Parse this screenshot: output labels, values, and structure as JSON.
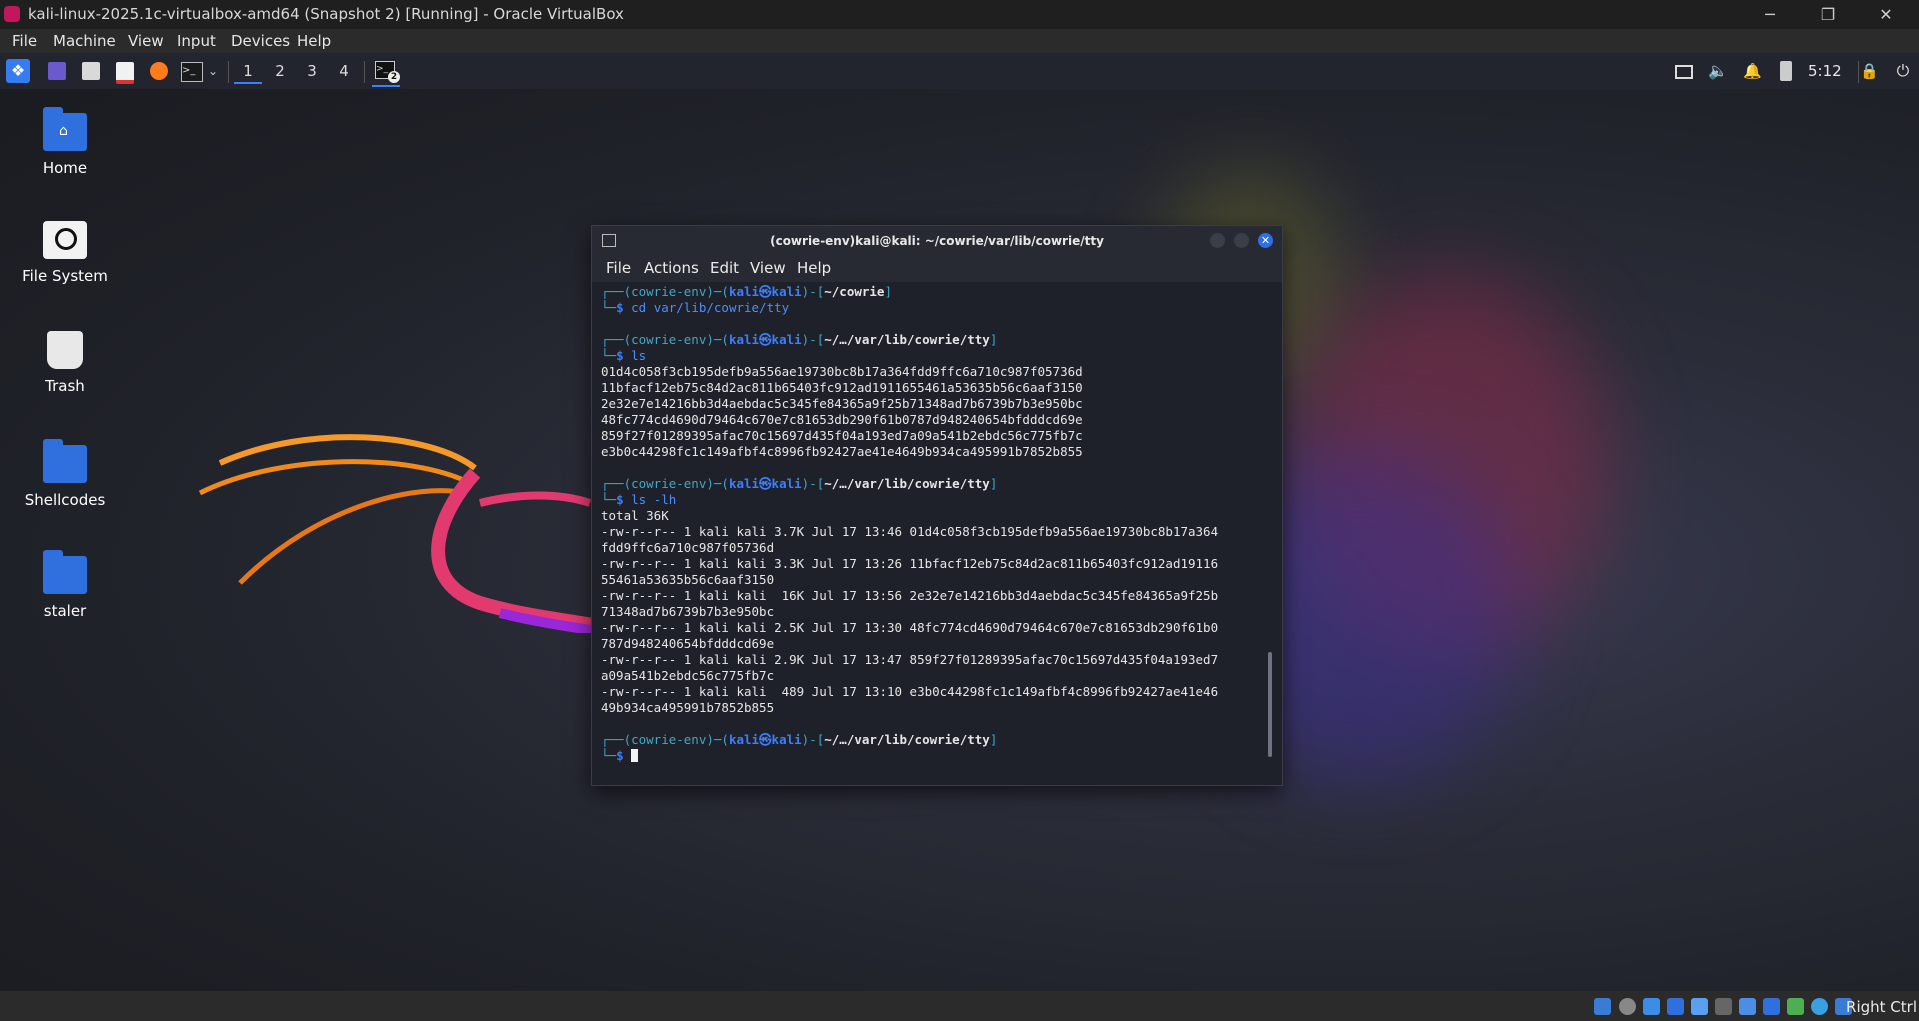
{
  "vbox": {
    "window_title": "kali-linux-2025.1c-virtualbox-amd64 (Snapshot 2) [Running] - Oracle VirtualBox",
    "menu": [
      "File",
      "Machine",
      "View",
      "Input",
      "Devices",
      "Help"
    ],
    "host_key": "Right Ctrl",
    "window_buttons": [
      "─",
      "❐",
      "✕"
    ]
  },
  "panel": {
    "workspaces": [
      "1",
      "2",
      "3",
      "4"
    ],
    "active_workspace": "1",
    "terminal_badge": "2",
    "clock": "5:12",
    "icons": [
      "kali-menu-icon",
      "desktop-icon",
      "file-manager-icon",
      "text-editor-icon",
      "firefox-icon",
      "terminal-icon",
      "display-icon",
      "volume-icon",
      "notification-bell-icon",
      "battery-icon",
      "lock-icon",
      "power-icon"
    ]
  },
  "desktop": {
    "icons": [
      {
        "label": "Home",
        "icon": "home-folder-icon"
      },
      {
        "label": "File System",
        "icon": "drive-icon"
      },
      {
        "label": "Trash",
        "icon": "trash-icon"
      },
      {
        "label": "Shellcodes",
        "icon": "folder-icon"
      },
      {
        "label": "staler",
        "icon": "folder-icon"
      }
    ]
  },
  "terminal": {
    "title": "(cowrie-env)kali@kali: ~/cowrie/var/lib/cowrie/tty",
    "menu": [
      "File",
      "Actions",
      "Edit",
      "View",
      "Help"
    ],
    "prompt": {
      "env": "(cowrie-env)",
      "user_host": "kali㉿kali",
      "dir1": "~/cowrie",
      "dir2": "~/…/var/lib/cowrie/tty"
    },
    "commands": [
      "cd var/lib/cowrie/tty",
      "ls",
      "ls -lh"
    ],
    "ls_output": [
      "01d4c058f3cb195defb9a556ae19730bc8b17a364fdd9ffc6a710c987f05736d",
      "11bfacf12eb75c84d2ac811b65403fc912ad1911655461a53635b56c6aaf3150",
      "2e32e7e14216bb3d4aebdac5c345fe84365a9f25b71348ad7b6739b7b3e950bc",
      "48fc774cd4690d79464c670e7c81653db290f61b0787d948240654bfdddcd69e",
      "859f27f01289395afac70c15697d435f04a193ed7a09a541b2ebdc56c775fb7c",
      "e3b0c44298fc1c149afbf4c8996fb92427ae41e4649b934ca495991b7852b855"
    ],
    "lslh_output": [
      "total 36K",
      "-rw-r--r-- 1 kali kali 3.7K Jul 17 13:46 01d4c058f3cb195defb9a556ae19730bc8b17a364",
      "fdd9ffc6a710c987f05736d",
      "-rw-r--r-- 1 kali kali 3.3K Jul 17 13:26 11bfacf12eb75c84d2ac811b65403fc912ad19116",
      "55461a53635b56c6aaf3150",
      "-rw-r--r-- 1 kali kali  16K Jul 17 13:56 2e32e7e14216bb3d4aebdac5c345fe84365a9f25b",
      "71348ad7b6739b7b3e950bc",
      "-rw-r--r-- 1 kali kali 2.5K Jul 17 13:30 48fc774cd4690d79464c670e7c81653db290f61b0",
      "787d948240654bfdddcd69e",
      "-rw-r--r-- 1 kali kali 2.9K Jul 17 13:47 859f27f01289395afac70c15697d435f04a193ed7",
      "a09a541b2ebdc56c775fb7c",
      "-rw-r--r-- 1 kali kali  489 Jul 17 13:10 e3b0c44298fc1c149afbf4c8996fb92427ae41e46",
      "49b934ca495991b7852b855"
    ]
  },
  "colors": {
    "accent": "#3d7dff",
    "kali_dragon": "#e23a6e",
    "folder": "#2f6fde"
  }
}
